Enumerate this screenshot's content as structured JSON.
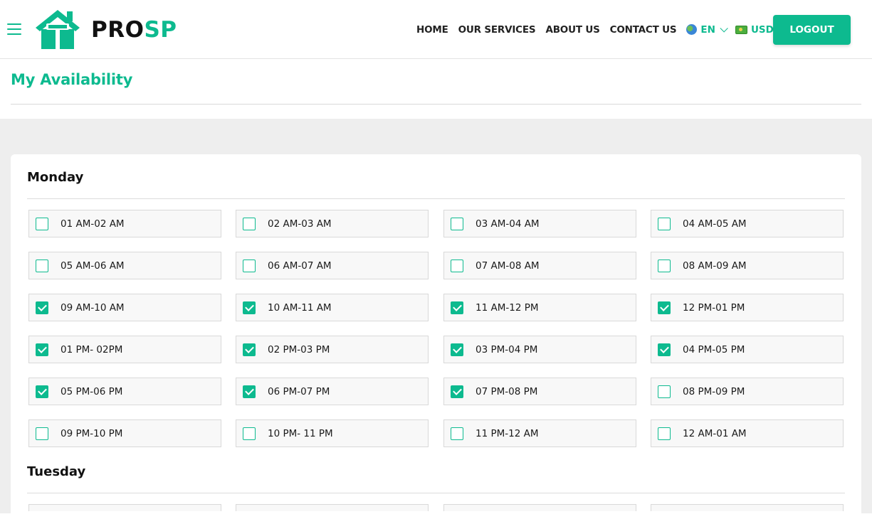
{
  "brand": {
    "name_part1": "PRO",
    "name_part2": "SP",
    "accent": "#0dba8f"
  },
  "nav": {
    "items": [
      "HOME",
      "OUR SERVICES",
      "ABOUT US",
      "CONTACT US"
    ],
    "language": {
      "icon": "globe-icon",
      "label": "EN"
    },
    "currency": {
      "icon": "money-icon",
      "label": "USD"
    },
    "logout_label": "LOGOUT"
  },
  "page": {
    "title": "My Availability"
  },
  "days": [
    {
      "name": "Monday",
      "slots": [
        {
          "label": "01 AM-02 AM",
          "checked": false
        },
        {
          "label": "02 AM-03 AM",
          "checked": false
        },
        {
          "label": "03 AM-04 AM",
          "checked": false
        },
        {
          "label": "04 AM-05 AM",
          "checked": false
        },
        {
          "label": "05 AM-06 AM",
          "checked": false
        },
        {
          "label": "06 AM-07 AM",
          "checked": false
        },
        {
          "label": "07 AM-08 AM",
          "checked": false
        },
        {
          "label": "08 AM-09 AM",
          "checked": false
        },
        {
          "label": "09 AM-10 AM",
          "checked": true
        },
        {
          "label": "10 AM-11 AM",
          "checked": true
        },
        {
          "label": "11 AM-12 PM",
          "checked": true
        },
        {
          "label": "12 PM-01 PM",
          "checked": true
        },
        {
          "label": "01 PM- 02PM",
          "checked": true
        },
        {
          "label": "02 PM-03 PM",
          "checked": true
        },
        {
          "label": "03 PM-04 PM",
          "checked": true
        },
        {
          "label": "04 PM-05 PM",
          "checked": true
        },
        {
          "label": "05 PM-06 PM",
          "checked": true
        },
        {
          "label": "06 PM-07 PM",
          "checked": true
        },
        {
          "label": "07 PM-08 PM",
          "checked": true
        },
        {
          "label": "08 PM-09 PM",
          "checked": false
        },
        {
          "label": "09 PM-10 PM",
          "checked": false
        },
        {
          "label": "10 PM- 11 PM",
          "checked": false
        },
        {
          "label": "11 PM-12 AM",
          "checked": false
        },
        {
          "label": "12 AM-01 AM",
          "checked": false
        }
      ]
    },
    {
      "name": "Tuesday",
      "slots": []
    }
  ]
}
